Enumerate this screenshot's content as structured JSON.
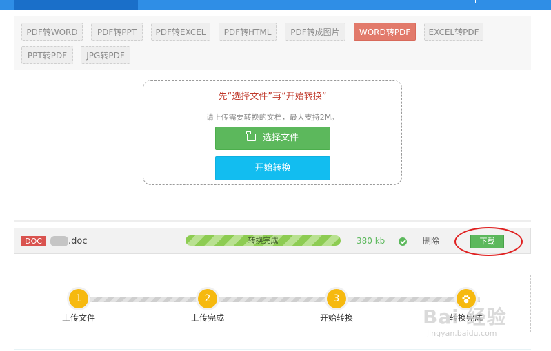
{
  "tabs": [
    {
      "label": "PDF转WORD",
      "active": false
    },
    {
      "label": "PDF转PPT",
      "active": false
    },
    {
      "label": "PDF转EXCEL",
      "active": false
    },
    {
      "label": "PDF转HTML",
      "active": false
    },
    {
      "label": "PDF转成图片",
      "active": false
    },
    {
      "label": "WORD转PDF",
      "active": true
    },
    {
      "label": "EXCEL转PDF",
      "active": false
    },
    {
      "label": "PPT转PDF",
      "active": false
    },
    {
      "label": "JPG转PDF",
      "active": false
    }
  ],
  "upload": {
    "title": "先“选择文件”再“开始转换”",
    "hint": "请上传需要转换的文档，最大支持2M。",
    "select_label": "选择文件",
    "convert_label": "开始转换"
  },
  "file": {
    "type_badge": "DOC",
    "name": ".doc",
    "status": "转换完成",
    "progress_percent": 100,
    "size": "380 kb",
    "delete_label": "删除",
    "download_label": "下载"
  },
  "steps": [
    {
      "number": "1",
      "label": "上传文件"
    },
    {
      "number": "2",
      "label": "上传完成"
    },
    {
      "number": "3",
      "label": "开始转换"
    },
    {
      "number": "",
      "label": "转换完成"
    }
  ],
  "watermark": {
    "main": "Bai 经验",
    "sub": "jingyan.baidu.com"
  },
  "colors": {
    "header_blue": "#2f8ee6",
    "active_tab": "#e27a6b",
    "select_green": "#5cb85c",
    "convert_blue": "#12bdf0",
    "step_yellow": "#f6b90f",
    "highlight_red": "#e02020"
  }
}
